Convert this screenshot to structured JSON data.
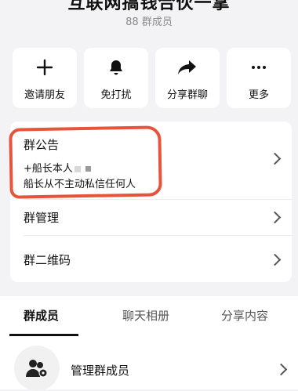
{
  "header": {
    "group_name": "互联网搞钱合伙一掌",
    "member_count": "88 群成员"
  },
  "actions": [
    {
      "label": "邀请朋友",
      "icon": "plus-icon"
    },
    {
      "label": "免打扰",
      "icon": "bell-icon"
    },
    {
      "label": "分享群聊",
      "icon": "share-icon"
    },
    {
      "label": "更多",
      "icon": "more-icon"
    }
  ],
  "notice": {
    "title": "群公告",
    "line1": "+船长本人",
    "line2": "船长从不主动私信任何人"
  },
  "rows": {
    "manage": "群管理",
    "qr": "群二维码"
  },
  "tabs": [
    "群成员",
    "聊天相册",
    "分享内容"
  ],
  "member_section": {
    "manage_members": "管理群成员"
  },
  "colors": {
    "annotation_red": "#e8533c",
    "background": "#f3f3f5"
  }
}
